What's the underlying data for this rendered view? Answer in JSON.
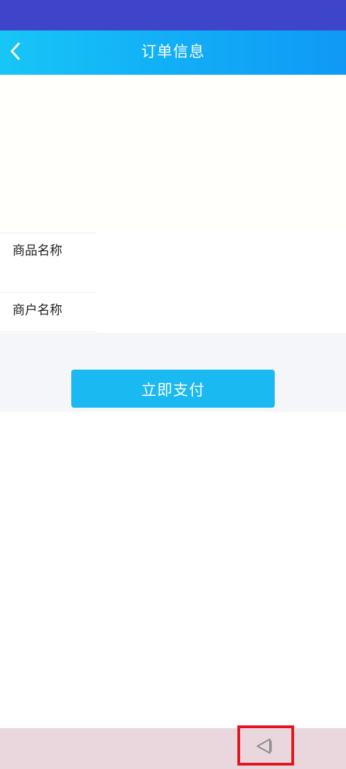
{
  "header": {
    "title": "订单信息",
    "back_icon": "chevron-left-icon"
  },
  "order_info": {
    "rows": [
      {
        "label": "商品名称",
        "value": ""
      },
      {
        "label": "商户名称",
        "value": ""
      }
    ]
  },
  "actions": {
    "pay_label": "立即支付"
  },
  "system_nav": {
    "back_icon": "nav-back-triangle-icon",
    "highlight_color": "#e3141e"
  },
  "colors": {
    "status_bar": "#3f45c8",
    "header_start": "#17c6f6",
    "header_end": "#0f99f5",
    "pay_button": "#1ab9f1",
    "nav_bar": "#ead7de"
  }
}
